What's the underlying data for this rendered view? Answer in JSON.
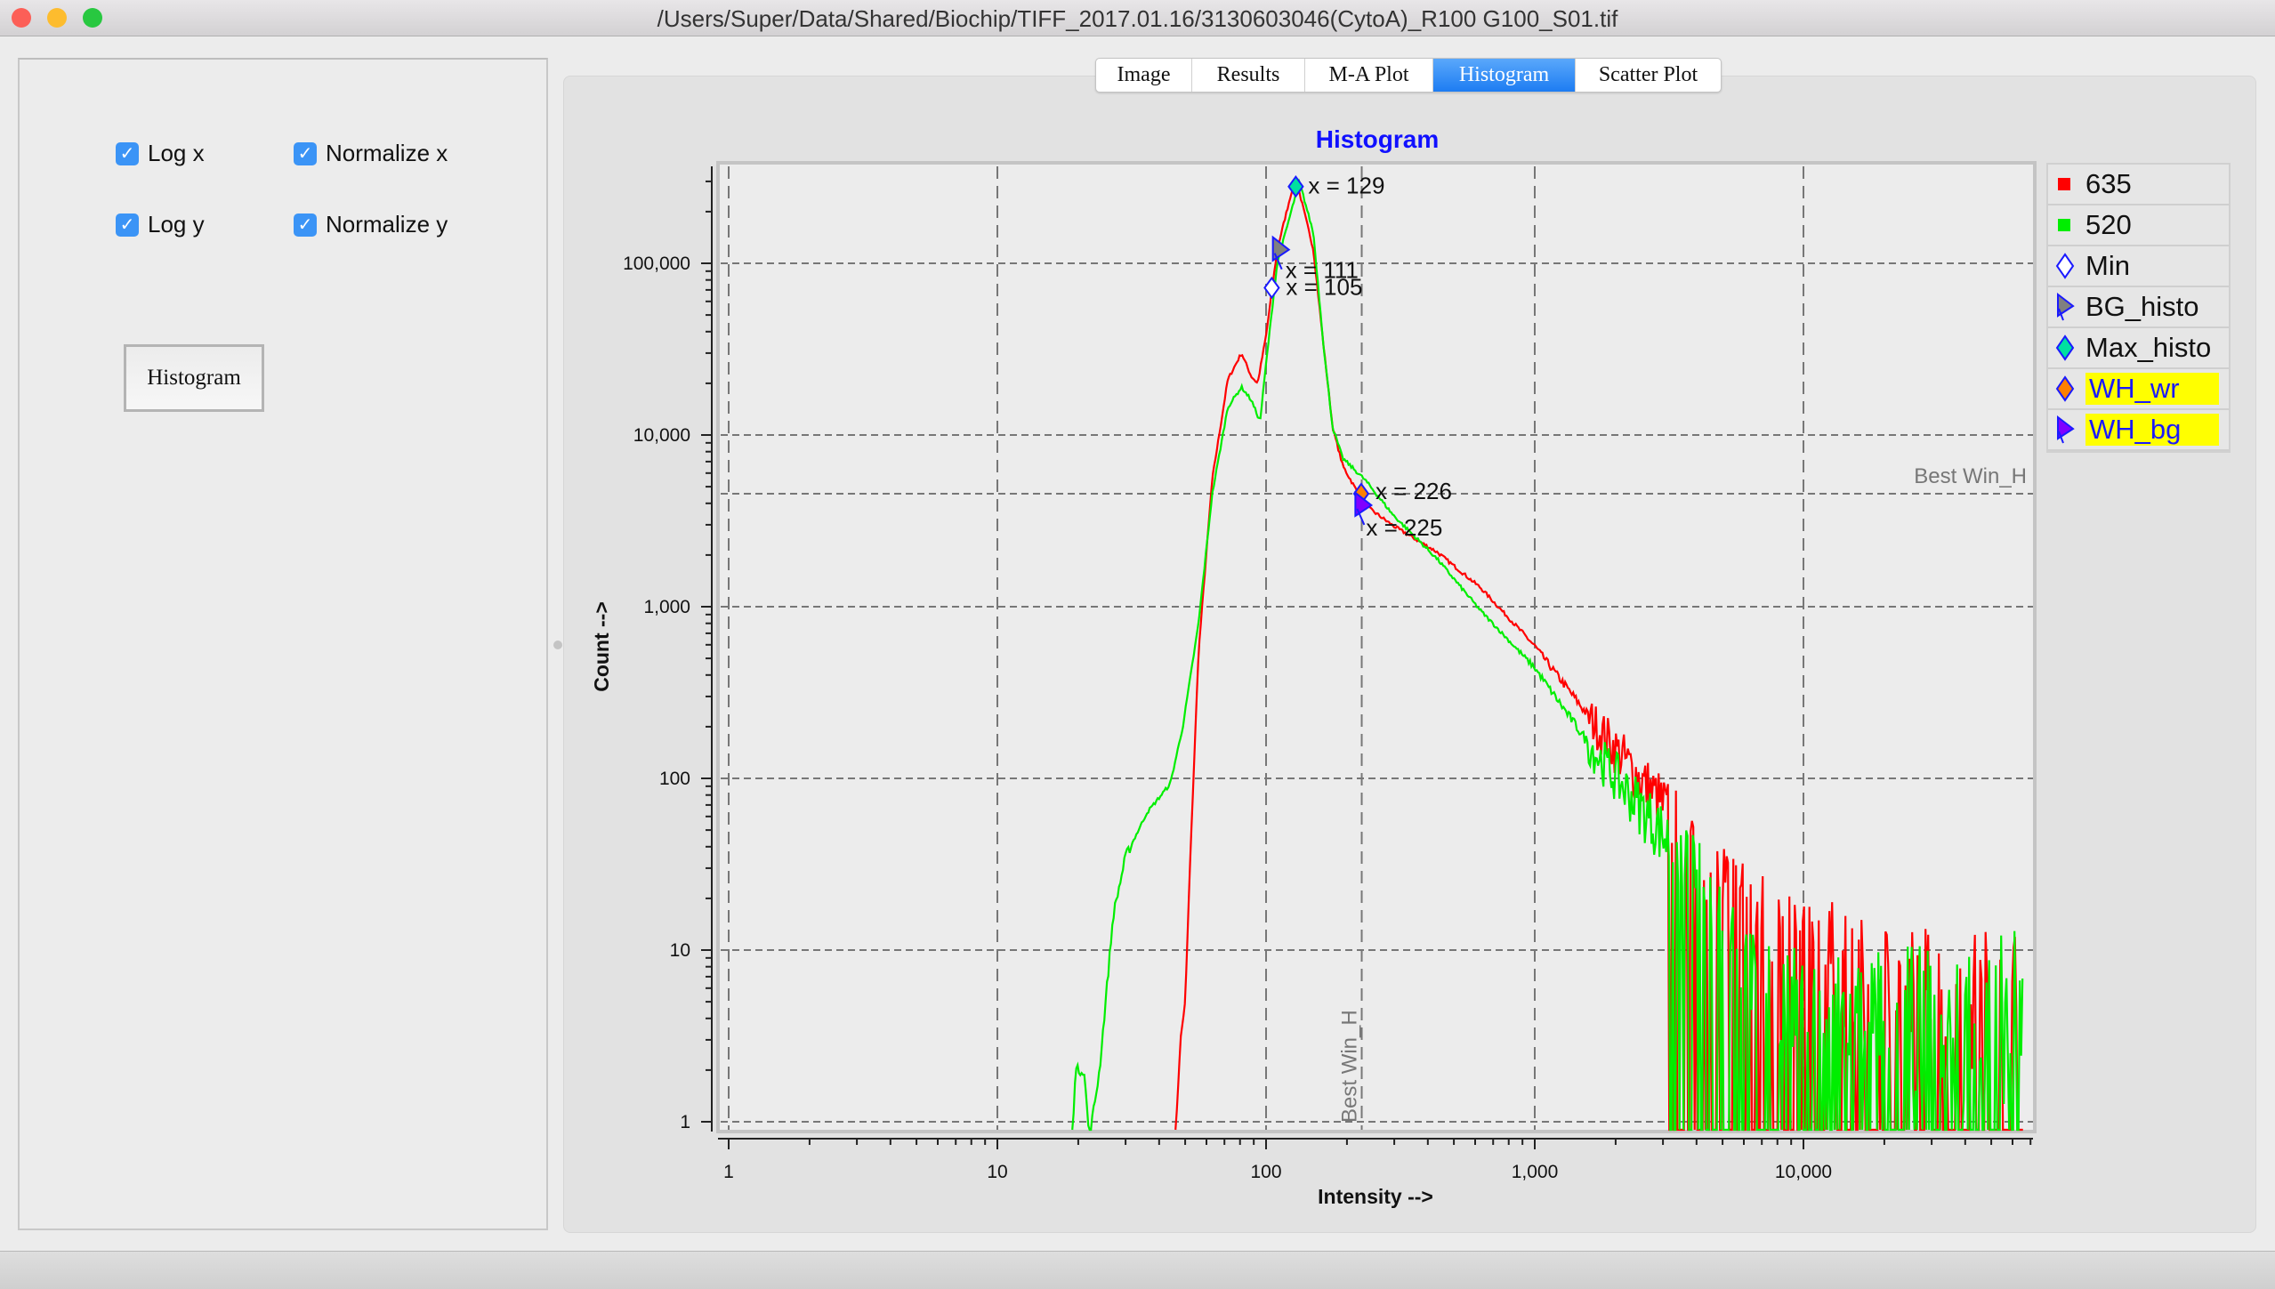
{
  "window": {
    "title": "/Users/Super/Data/Shared/Biochip/TIFF_2017.01.16/3130603046(CytoA)_R100 G100_S01.tif"
  },
  "controls": {
    "log_x": {
      "label": "Log x",
      "checked": true
    },
    "normalize_x": {
      "label": "Normalize x",
      "checked": true
    },
    "log_y": {
      "label": "Log y",
      "checked": true
    },
    "normalize_y": {
      "label": "Normalize y",
      "checked": true
    },
    "histogram_button": "Histogram"
  },
  "tabs": [
    {
      "label": "Image"
    },
    {
      "label": "Results"
    },
    {
      "label": "M-A Plot"
    },
    {
      "label": "Histogram",
      "active": true
    },
    {
      "label": "Scatter Plot"
    }
  ],
  "legend": [
    {
      "label": "635",
      "icon": "red-square",
      "color": "#ff0000"
    },
    {
      "label": "520",
      "icon": "green-square",
      "color": "#00ee00"
    },
    {
      "label": "Min",
      "icon": "hollow-diamond",
      "color": "#ffffff"
    },
    {
      "label": "BG_histo",
      "icon": "gray-triangle",
      "color": "#808080"
    },
    {
      "label": "Max_histo",
      "icon": "teal-diamond",
      "color": "#00e0a0"
    },
    {
      "label": "WH_wr",
      "icon": "orange-diamond",
      "color": "#ff8000",
      "highlight": true
    },
    {
      "label": "WH_bg",
      "icon": "purple-triangle",
      "color": "#8000ff",
      "highlight": true
    }
  ],
  "chart_data": {
    "type": "line",
    "title": "Histogram",
    "xlabel": "Intensity -->",
    "ylabel": "Count -->",
    "xscale": "log",
    "yscale": "log",
    "xlim": [
      1,
      70000
    ],
    "ylim": [
      1,
      400000
    ],
    "grid": true,
    "legend": "right",
    "xticks": [
      {
        "v": 1,
        "label": "1"
      },
      {
        "v": 10,
        "label": "10"
      },
      {
        "v": 100,
        "label": "100"
      },
      {
        "v": 1000,
        "label": "1,000"
      },
      {
        "v": 10000,
        "label": "10,000"
      }
    ],
    "yticks": [
      {
        "v": 1,
        "label": "1"
      },
      {
        "v": 10,
        "label": "10"
      },
      {
        "v": 100,
        "label": "100"
      },
      {
        "v": 1000,
        "label": "1,000"
      },
      {
        "v": 10000,
        "label": "10,000"
      },
      {
        "v": 100000,
        "label": "100,000"
      }
    ],
    "series": [
      {
        "name": "635",
        "color": "#ff0000",
        "points": [
          [
            46,
            0.8
          ],
          [
            48,
            3
          ],
          [
            50,
            5
          ],
          [
            52,
            29
          ],
          [
            56,
            530
          ],
          [
            63,
            5500
          ],
          [
            72,
            21000
          ],
          [
            81,
            30000
          ],
          [
            88,
            22000
          ],
          [
            93,
            20000
          ],
          [
            100,
            38000
          ],
          [
            110,
            120000
          ],
          [
            125,
            270000
          ],
          [
            131,
            285000
          ],
          [
            150,
            120000
          ],
          [
            164,
            32000
          ],
          [
            177,
            11000
          ],
          [
            193,
            6600
          ],
          [
            233,
            3900
          ],
          [
            298,
            2950
          ],
          [
            433,
            2080
          ],
          [
            628,
            1290
          ],
          [
            1000,
            590
          ],
          [
            1700,
            200
          ],
          [
            3150,
            63
          ],
          [
            5200,
            24
          ],
          [
            9700,
            11
          ],
          [
            20000,
            6
          ],
          [
            66000,
            4
          ]
        ]
      },
      {
        "name": "520",
        "color": "#00ee00",
        "points": [
          [
            19,
            0.8
          ],
          [
            19.5,
            2
          ],
          [
            21,
            2
          ],
          [
            22,
            0.8
          ],
          [
            24,
            2
          ],
          [
            27,
            16
          ],
          [
            30,
            35
          ],
          [
            36,
            63
          ],
          [
            44,
            93
          ],
          [
            49,
            200
          ],
          [
            56,
            790
          ],
          [
            63,
            4500
          ],
          [
            72,
            14500
          ],
          [
            81,
            19000
          ],
          [
            88,
            16000
          ],
          [
            95,
            12000
          ],
          [
            100,
            26000
          ],
          [
            110,
            100000
          ],
          [
            133,
            300000
          ],
          [
            150,
            150000
          ],
          [
            164,
            32000
          ],
          [
            177,
            11000
          ],
          [
            193,
            7300
          ],
          [
            233,
            5500
          ],
          [
            298,
            3400
          ],
          [
            433,
            1900
          ],
          [
            628,
            950
          ],
          [
            1000,
            440
          ],
          [
            1700,
            137
          ],
          [
            3150,
            43
          ],
          [
            5200,
            16
          ],
          [
            6700,
            6
          ],
          [
            9700,
            5
          ],
          [
            20000,
            4
          ],
          [
            66000,
            4
          ]
        ]
      }
    ],
    "markers": [
      {
        "name": "Max_histo",
        "x": 129,
        "y": 280000,
        "label": "x = 129",
        "shape": "diamond",
        "color": "#00e0a0"
      },
      {
        "name": "BG_histo",
        "x": 111,
        "y": 120000,
        "label": "x = 111",
        "shape": "triangle",
        "color": "#808080"
      },
      {
        "name": "Min",
        "x": 105,
        "y": 72000,
        "label": "x = 105",
        "shape": "diamond",
        "color": "#ffffff"
      },
      {
        "name": "WH_wr",
        "x": 226,
        "y": 4550,
        "label": "x = 226",
        "shape": "diamond",
        "color": "#ff8000"
      },
      {
        "name": "WH_bg",
        "x": 225,
        "y": 3900,
        "label": "x = 225",
        "shape": "triangle",
        "color": "#8000ff"
      }
    ],
    "reference_lines": [
      {
        "orientation": "horizontal",
        "value": 4550,
        "label": "Best Win_H"
      },
      {
        "orientation": "vertical",
        "value": 227,
        "label": "Best Win_H"
      }
    ]
  }
}
